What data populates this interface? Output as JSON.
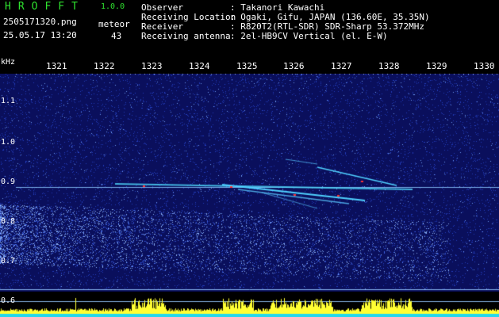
{
  "header": {
    "brand": "HROFFT",
    "version": "1.0.0",
    "filename": "2505171320.png",
    "timestamp": "25.05.17 13:20",
    "meteor_label": "meteor",
    "meteor_count": "43",
    "info": [
      {
        "label": "Observer",
        "value": ": Takanori Kawachi"
      },
      {
        "label": "Receiving Location",
        "value": ": Ogaki, Gifu, JAPAN (136.60E, 35.35N)"
      },
      {
        "label": "Receiver",
        "value": ": R820T2(RTL-SDR) SDR-Sharp 53.372MHz"
      },
      {
        "label": "Receiving antenna",
        "value": ": 2el-HB9CV Vertical (el. E-W)"
      }
    ]
  },
  "axes": {
    "y_unit": "kHz",
    "x_ticks": [
      "1321",
      "1322",
      "1323",
      "1324",
      "1325",
      "1326",
      "1327",
      "1328",
      "1329",
      "1330"
    ],
    "y_ticks": [
      "1.1",
      "1.0",
      "0.9",
      "0.8",
      "0.7",
      "0.6"
    ]
  },
  "colors": {
    "background": "#000000",
    "spectrum_bg": "#0a0f5c",
    "signal": "#4fd0ff",
    "hot": "#ff3030",
    "text_green": "#2fe22f",
    "text_white": "#ffffff",
    "level_yellow": "#ffff33",
    "level_cyan": "#22d8ee"
  }
}
